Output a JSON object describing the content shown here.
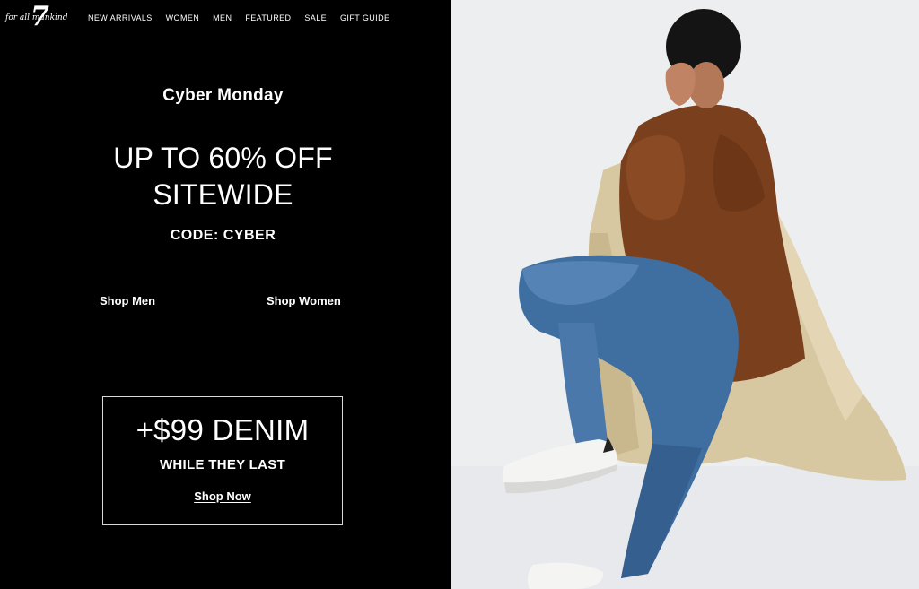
{
  "brand": {
    "logo_text": "for all mankind",
    "logo_mark": "7"
  },
  "nav": {
    "items": [
      {
        "label": "NEW ARRIVALS"
      },
      {
        "label": "WOMEN"
      },
      {
        "label": "MEN"
      },
      {
        "label": "FEATURED"
      },
      {
        "label": "SALE"
      },
      {
        "label": "GIFT GUIDE"
      }
    ]
  },
  "hero": {
    "eyebrow": "Cyber Monday",
    "headline_line1": "UP TO 60% OFF",
    "headline_line2": "SITEWIDE",
    "code": "CODE: CYBER",
    "shop_men": "Shop Men",
    "shop_women": "Shop Women"
  },
  "promo": {
    "title": "+$99 DENIM",
    "subtitle": "WHILE THEY LAST",
    "link": "Shop Now"
  },
  "colors": {
    "left_background": "#000000",
    "right_background": "#eceef0",
    "text": "#ffffff",
    "coat": "#7a3f1d",
    "denim": "#3f6ea1",
    "drape": "#d9c9a3"
  }
}
